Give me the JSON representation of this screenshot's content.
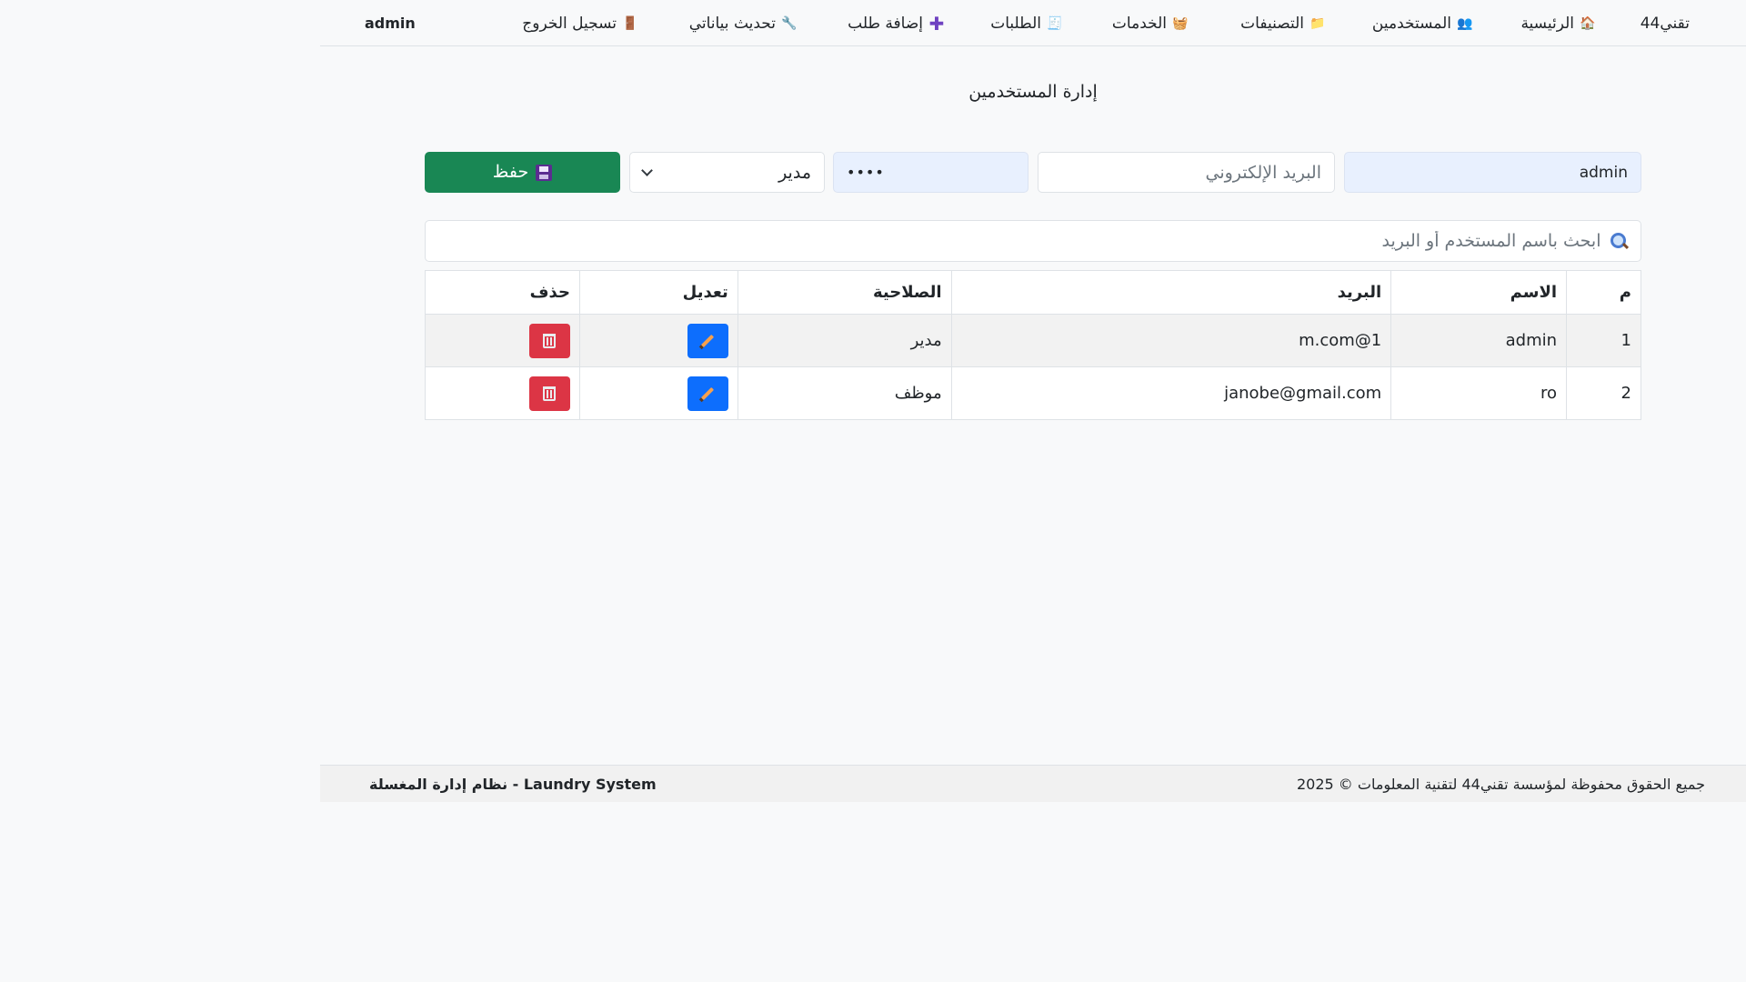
{
  "nav": {
    "brand": "تقني44",
    "items": [
      {
        "label": "الرئيسية",
        "icon": "house-icon"
      },
      {
        "label": "المستخدمين",
        "icon": "users-icon"
      },
      {
        "label": "التصنيفات",
        "icon": "folder-icon"
      },
      {
        "label": "الخدمات",
        "icon": "basket-icon"
      },
      {
        "label": "الطلبات",
        "icon": "receipt-icon"
      },
      {
        "label": "إضافة طلب",
        "icon": "plus-icon"
      },
      {
        "label": "تحديث بياناتي",
        "icon": "wrench-icon"
      },
      {
        "label": "تسجيل الخروج",
        "icon": "door-icon"
      }
    ],
    "user": "admin"
  },
  "page": {
    "title": "إدارة المستخدمين"
  },
  "form": {
    "username_value": "admin",
    "email_placeholder": "البريد الإلكتروني",
    "email_value": "",
    "password_value": "••••",
    "role_value": "مدير",
    "save_label": "حفظ"
  },
  "search": {
    "placeholder": "ابحث باسم المستخدم أو البريد"
  },
  "table": {
    "headers": {
      "num": "م",
      "name": "الاسم",
      "email": "البريد",
      "role": "الصلاحية",
      "edit": "تعديل",
      "delete": "حذف"
    },
    "rows": [
      {
        "num": "1",
        "name": "admin",
        "email": "m.com@1",
        "role": "مدير"
      },
      {
        "num": "2",
        "name": "ro",
        "email": "janobe@gmail.com",
        "role": "موظف"
      }
    ]
  },
  "footer": {
    "copyright": "جميع الحقوق محفوظة لمؤسسة تقني44 لتقنية المعلومات © 2025",
    "app_name": "Laundry System - نظام إدارة المغسلة"
  },
  "colors": {
    "primary": "#0d6efd",
    "success": "#198754",
    "danger": "#dc3545"
  }
}
